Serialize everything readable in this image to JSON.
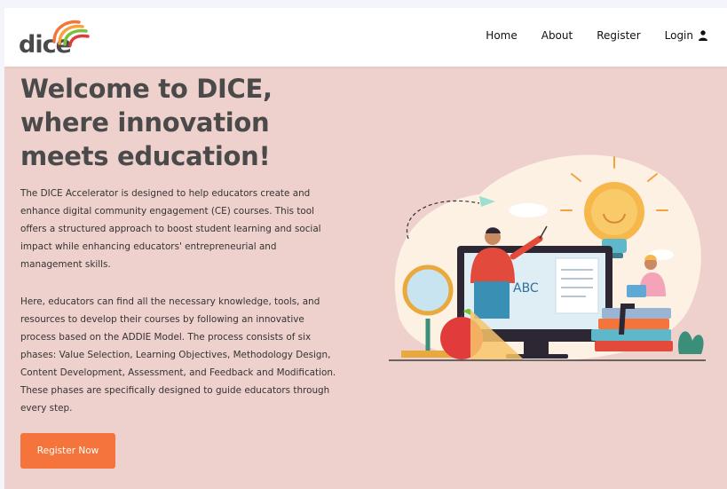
{
  "brand": {
    "logo_text": "dice",
    "accent_colors": [
      "#f4743b",
      "#7cbf3a",
      "#e23b3b"
    ]
  },
  "nav": {
    "links": [
      {
        "label": "Home"
      },
      {
        "label": "About"
      },
      {
        "label": "Register"
      }
    ],
    "login": {
      "label": "Login",
      "icon": "user-icon"
    }
  },
  "hero": {
    "title": "Welcome to DICE, where innovation meets education!",
    "paragraph_1": "The DICE Accelerator is designed to help educators create and enhance digital community engagement (CE) courses. This tool offers a structured approach to boost student learning and social impact while enhancing educators' entrepreneurial and management skills.",
    "paragraph_2": "Here, educators can find all the necessary knowledge, tools, and resources to develop their courses by following an innovative process based on the ADDIE Model. The process consists of six phases: Value Selection, Learning Objectives, Methodology Design, Content Development, Assessment, and Feedback and Modification. These phases are specifically designed to guide educators through every step.",
    "cta_label": "Register Now",
    "cta_color": "#f4743b",
    "background_color": "#eed1cd"
  },
  "illustration": {
    "board_text": "ABC"
  }
}
